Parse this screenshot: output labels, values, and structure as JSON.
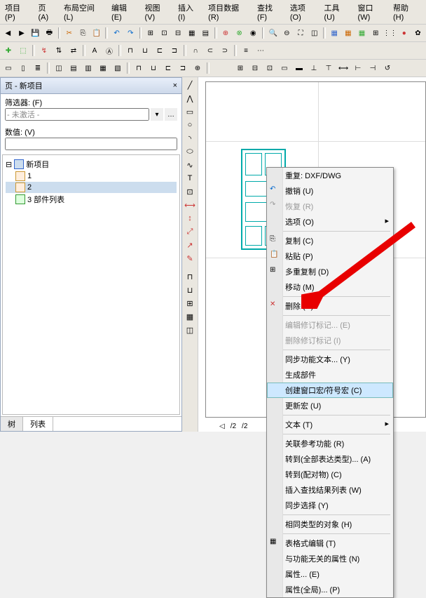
{
  "menu": {
    "items": [
      "项目 (P)",
      "页 (A)",
      "布局空间 (L)",
      "编辑 (E)",
      "视图 (V)",
      "插入 (I)",
      "项目数据 (R)",
      "查找 (F)",
      "选项 (O)",
      "工具 (U)",
      "窗口 (W)",
      "帮助 (H)"
    ]
  },
  "panel": {
    "title": "页 - 新项目",
    "close": "×",
    "filterLabel": "筛选器: (F)",
    "filterValue": "- 未激活 -",
    "valueLabel": "数值: (V)",
    "valueValue": ""
  },
  "tree": {
    "root": "新项目",
    "items": [
      "1",
      "2",
      "3 部件列表"
    ],
    "selIndex": 1
  },
  "tabs": {
    "left": "树",
    "right": "列表"
  },
  "pagebar": {
    "cur": "/2",
    "total": "/2"
  },
  "ctx": {
    "reset": "重复: DXF/DWG",
    "undo": "撤销 (U)",
    "redo": "恢复 (R)",
    "options": "选项 (O)",
    "copy": "复制 (C)",
    "paste": "粘贴 (P)",
    "dup": "多重复制 (D)",
    "move": "移动 (M)",
    "delete": "删除 (D)",
    "editrev": "编辑修订标记... (E)",
    "delrev": "删除修订标记 (I)",
    "syncfunc": "同步功能文本... (Y)",
    "genpart": "生成部件",
    "createwin": "创建窗口宏/符号宏 (C)",
    "updmacro": "更新宏 (U)",
    "text": "文本 (T)",
    "unlink": "关联参考功能 (R)",
    "conv1": "转到(全部表达类型)... (A)",
    "conv2": "转到(配对物) (C)",
    "insres": "插入查找结果列表 (W)",
    "syncsel": "同步选择 (Y)",
    "sameobj": "相同类型的对象 (H)",
    "tblstyle": "表格式编辑 (T)",
    "unrelprop": "与功能无关的属性 (N)",
    "prop": "属性... (E)",
    "propglob": "属性(全局)... (P)"
  }
}
